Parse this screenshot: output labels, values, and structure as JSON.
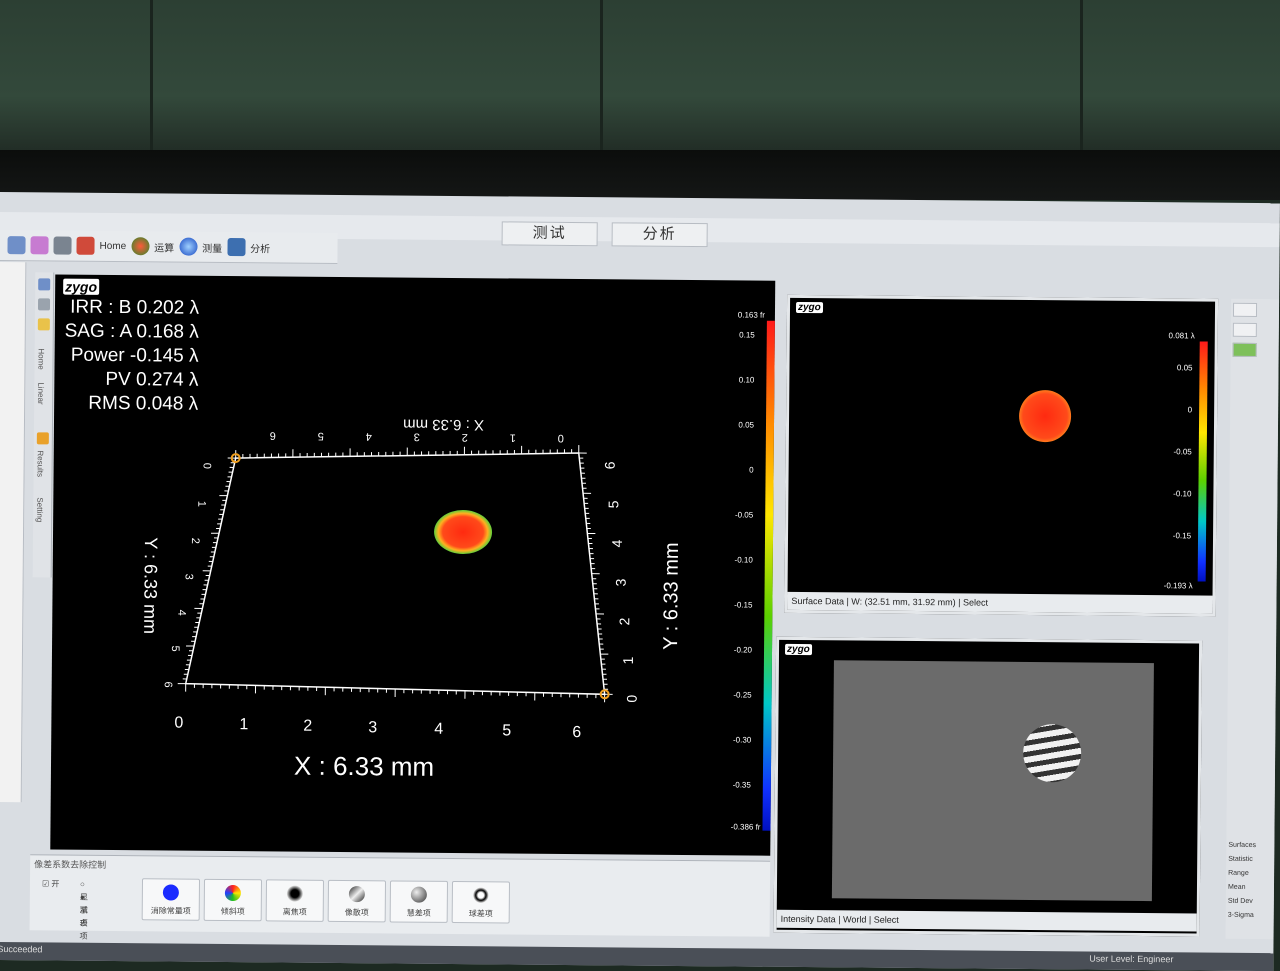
{
  "tabs": [
    "测试",
    "分析"
  ],
  "toolbar": {
    "items": [
      {
        "label": "Home",
        "icon": "home-icon"
      },
      {
        "label": "运算",
        "icon": "run-icon"
      },
      {
        "label": "测量",
        "icon": "measure-icon"
      },
      {
        "label": "分析",
        "icon": "analyze-icon"
      }
    ]
  },
  "left_strip": [
    "Home",
    "Linear",
    "Results",
    "Setting"
  ],
  "main": {
    "logo": "zygo",
    "metrics": [
      {
        "label": "IRR : B",
        "value": "0.202 λ"
      },
      {
        "label": "SAG : A",
        "value": "0.168 λ"
      },
      {
        "label": "Power",
        "value": "-0.145 λ"
      },
      {
        "label": "PV",
        "value": "0.274 λ"
      },
      {
        "label": "RMS",
        "value": "0.048 λ"
      }
    ],
    "x_label": "X : 6.33 mm",
    "x_label_mirrored": "X : 6.33 mm",
    "y_label_left": "Y : 6.33 mm",
    "y_label_right": "Y : 6.33 mm",
    "x_ticks": [
      "0",
      "1",
      "2",
      "3",
      "4",
      "5",
      "6"
    ],
    "y_ticks": [
      "0",
      "1",
      "2",
      "3",
      "4",
      "5",
      "6"
    ],
    "colorbar_top": "0.163 fr",
    "colorbar_bottom": "-0.386 fr",
    "colorbar_ticks": [
      "0.15",
      "0.10",
      "0.05",
      "0",
      "-0.05",
      "-0.10",
      "-0.15",
      "-0.20",
      "-0.25",
      "-0.30",
      "-0.35"
    ]
  },
  "surface_panel": {
    "logo": "zygo",
    "status_left": "Surface Data",
    "status_mid": "W: (32.51 mm, 31.92 mm)",
    "status_right": "Select",
    "colorbar_top": "0.081 λ",
    "colorbar_bottom": "-0.193 λ",
    "colorbar_ticks": [
      "0.05",
      "0",
      "-0.05",
      "-0.10",
      "-0.15"
    ]
  },
  "intensity_panel": {
    "logo": "zygo",
    "status_left": "Intensity Data",
    "status_mid": "World",
    "status_right": "Select"
  },
  "bottom_panel": {
    "title": "像差系数去除控制",
    "radio_options": [
      "显示项",
      "减去项"
    ],
    "checkbox_label": "开",
    "buttons": [
      "消除常量项",
      "倾斜项",
      "离焦项",
      "像散项",
      "慧差项",
      "球差项"
    ]
  },
  "right_rail": [
    "Surfaces",
    "Statistic",
    "Range",
    "Mean",
    "Std Dev",
    "3-Sigma"
  ],
  "status_bar": {
    "left": "Succeeded",
    "right": "User Level: Engineer"
  },
  "colors": {
    "accent": "#ff3b1a",
    "spot_edge": "#6bd34a",
    "screen_bg": "#000000"
  }
}
